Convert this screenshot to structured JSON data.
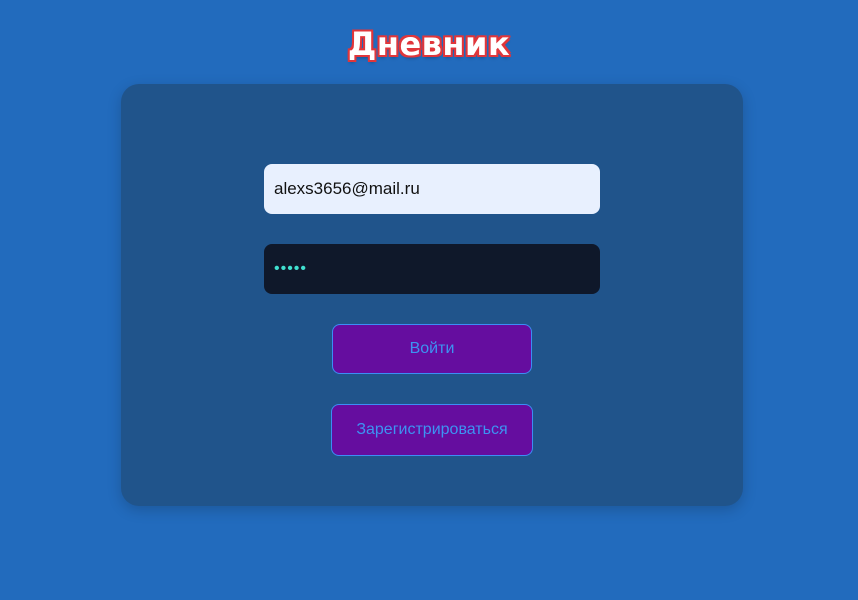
{
  "app": {
    "title": "Дневник"
  },
  "login_form": {
    "email": {
      "value": "alexs3656@mail.ru"
    },
    "password": {
      "value": "•••••"
    },
    "login_label": "Войти",
    "register_label": "Зарегистрироваться"
  },
  "colors": {
    "page_background": "#226bbd",
    "card_background": "#20548b",
    "button_background": "#650d9f",
    "button_text": "#3d93f2",
    "title_outline": "#e0363b"
  }
}
